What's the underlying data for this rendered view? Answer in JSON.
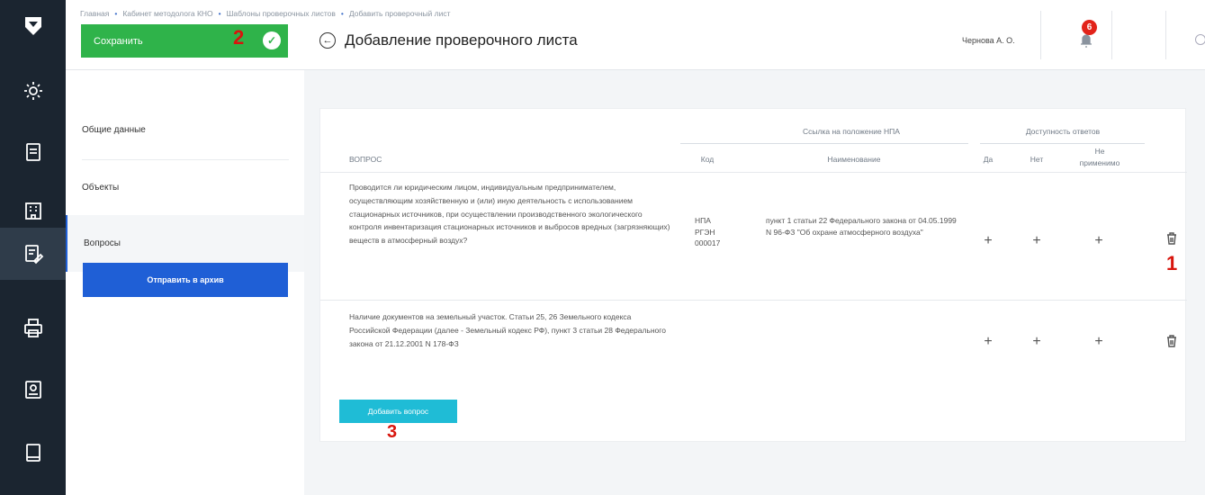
{
  "app": {
    "window_title": "Добавление проверочного листа"
  },
  "rail": {
    "items": [
      {
        "icon": "shield-logo-icon"
      },
      {
        "icon": "gear-icon"
      },
      {
        "icon": "document-icon"
      },
      {
        "icon": "building-icon"
      },
      {
        "icon": "edit-document-icon"
      },
      {
        "icon": "printer-icon"
      },
      {
        "icon": "certificate-icon"
      },
      {
        "icon": "book-icon"
      }
    ]
  },
  "header": {
    "breadcrumb": [
      "Главная",
      "Кабинет методолога КНО",
      "Шаблоны проверочных листов",
      "Добавить проверочный лист"
    ],
    "save_label": "Сохранить",
    "page_title": "Добавление проверочного листа",
    "user_name": "Чернова А. О.",
    "notifications_count": "6"
  },
  "callouts": {
    "c1": "1",
    "c2": "2",
    "c3": "3"
  },
  "subnav": {
    "items": [
      {
        "label": "Общие данные"
      },
      {
        "label": "Объекты"
      },
      {
        "label": "Вопросы"
      }
    ],
    "archive_label": "Отправить в архив"
  },
  "table": {
    "headers": {
      "question": "ВОПРОС",
      "npa_group": "Ссылка на положение НПА",
      "code": "Код",
      "name": "Наименование",
      "answers_group": "Доступность ответов",
      "yes": "Да",
      "no": "Нет",
      "na_line1": "Не",
      "na_line2": "применимо"
    },
    "rows": [
      {
        "question": "Проводится ли юридическим лицом, индивидуальным предпринимателем, осуществляющим хозяйственную и (или) иную деятельность с использованием стационарных источников, при осуществлении производственного экологического контроля инвентаризация стационарных источников и выбросов вредных (загрязняющих) веществ в атмосферный воздух?",
        "code": "НПА РГЭН 000017",
        "name": "пункт 1 статьи 22 Федерального закона от 04.05.1999 N 96-ФЗ \"Об охране атмосферного воздуха\"",
        "yes": "+",
        "no": "+",
        "na": "+"
      },
      {
        "question": "Наличие документов на земельный участок. Статьи 25, 26 Земельного кодекса Российской Федерации (далее - Земельный кодекс РФ), пункт 3 статьи 28 Федерального закона от 21.12.2001 N 178-ФЗ",
        "code": "",
        "name": "",
        "yes": "+",
        "no": "+",
        "na": "+"
      }
    ],
    "add_label": "Добавить вопрос"
  }
}
